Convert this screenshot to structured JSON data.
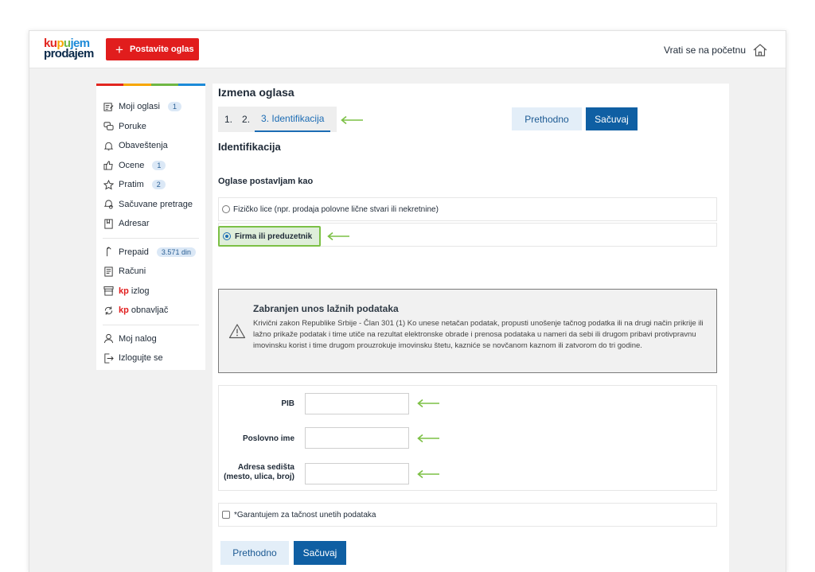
{
  "header": {
    "logo_line1": [
      "ku",
      "p",
      "u",
      "j",
      "em"
    ],
    "logo_line2": "prodajem",
    "post_button": "Postavite oglas",
    "home_link": "Vrati se na početnu"
  },
  "sidebar": {
    "stripe_colors": [
      "#e2261f",
      "#f7a600",
      "#6fb744",
      "#1c8ad8"
    ],
    "group1": [
      {
        "label": "Moji oglasi",
        "badge": "1",
        "icon": "edit-list-icon"
      },
      {
        "label": "Poruke",
        "badge": "",
        "icon": "chat-icon"
      },
      {
        "label": "Obaveštenja",
        "badge": "",
        "icon": "bell-icon"
      },
      {
        "label": "Ocene",
        "badge": "1",
        "icon": "thumbs-up-icon"
      },
      {
        "label": "Pratim",
        "badge": "2",
        "icon": "star-icon"
      },
      {
        "label": "Sačuvane pretrage",
        "badge": "",
        "icon": "saved-search-icon"
      },
      {
        "label": "Adresar",
        "badge": "",
        "icon": "address-book-icon"
      }
    ],
    "group2": [
      {
        "label": "Prepaid",
        "badge": "3.571 din",
        "icon": "prepaid-icon"
      },
      {
        "label": "Računi",
        "badge": "",
        "icon": "receipt-icon"
      },
      {
        "kp": "kp",
        "label": "izlog",
        "badge": "",
        "icon": "storefront-icon"
      },
      {
        "kp": "kp",
        "label": "obnavljač",
        "badge": "",
        "icon": "refresh-icon"
      }
    ],
    "group3": [
      {
        "label": "Moj nalog",
        "badge": "",
        "icon": "user-icon"
      },
      {
        "label": "Izlogujte se",
        "badge": "",
        "icon": "logout-icon"
      }
    ]
  },
  "main": {
    "title": "Izmena oglasa",
    "steps": [
      "1.",
      "2.",
      "3. Identifikacija"
    ],
    "prev_button": "Prethodno",
    "save_button": "Sačuvaj",
    "section_title": "Identifikacija",
    "subtitle": "Oglase postavljam kao",
    "option_individual": "Fizičko lice (npr. prodaja polovne lične stvari ili nekretnine)",
    "option_company": "Firma ili preduzetnik",
    "warning_title": "Zabranjen unos lažnih podataka",
    "warning_text": "Krivični zakon Republike Srbije - Član 301 (1) Ko unese netačan podatak, propusti unošenje tačnog podatka ili na drugi način prikrije ili lažno prikaže podatak i time utiče na rezultat elektronske obrade i prenosa podataka u nameri da sebi ili drugom pribavi protivpravnu imovinsku korist i time drugom prouzrokuje imovinsku štetu, kazniće se novčanom kaznom ili zatvorom do tri godine.",
    "fields": {
      "pib": "PIB",
      "business_name": "Poslovno ime",
      "address_line1": "Adresa sedišta",
      "address_line2": "(mesto, ulica, broj)"
    },
    "guarantee_label": "*Garantujem za tačnost unetih podataka"
  },
  "colors": {
    "accent_blue": "#0f5fa3",
    "light_blue": "#e3eef8",
    "brand_red": "#e11d1d",
    "annotation_green": "#7cc045"
  }
}
